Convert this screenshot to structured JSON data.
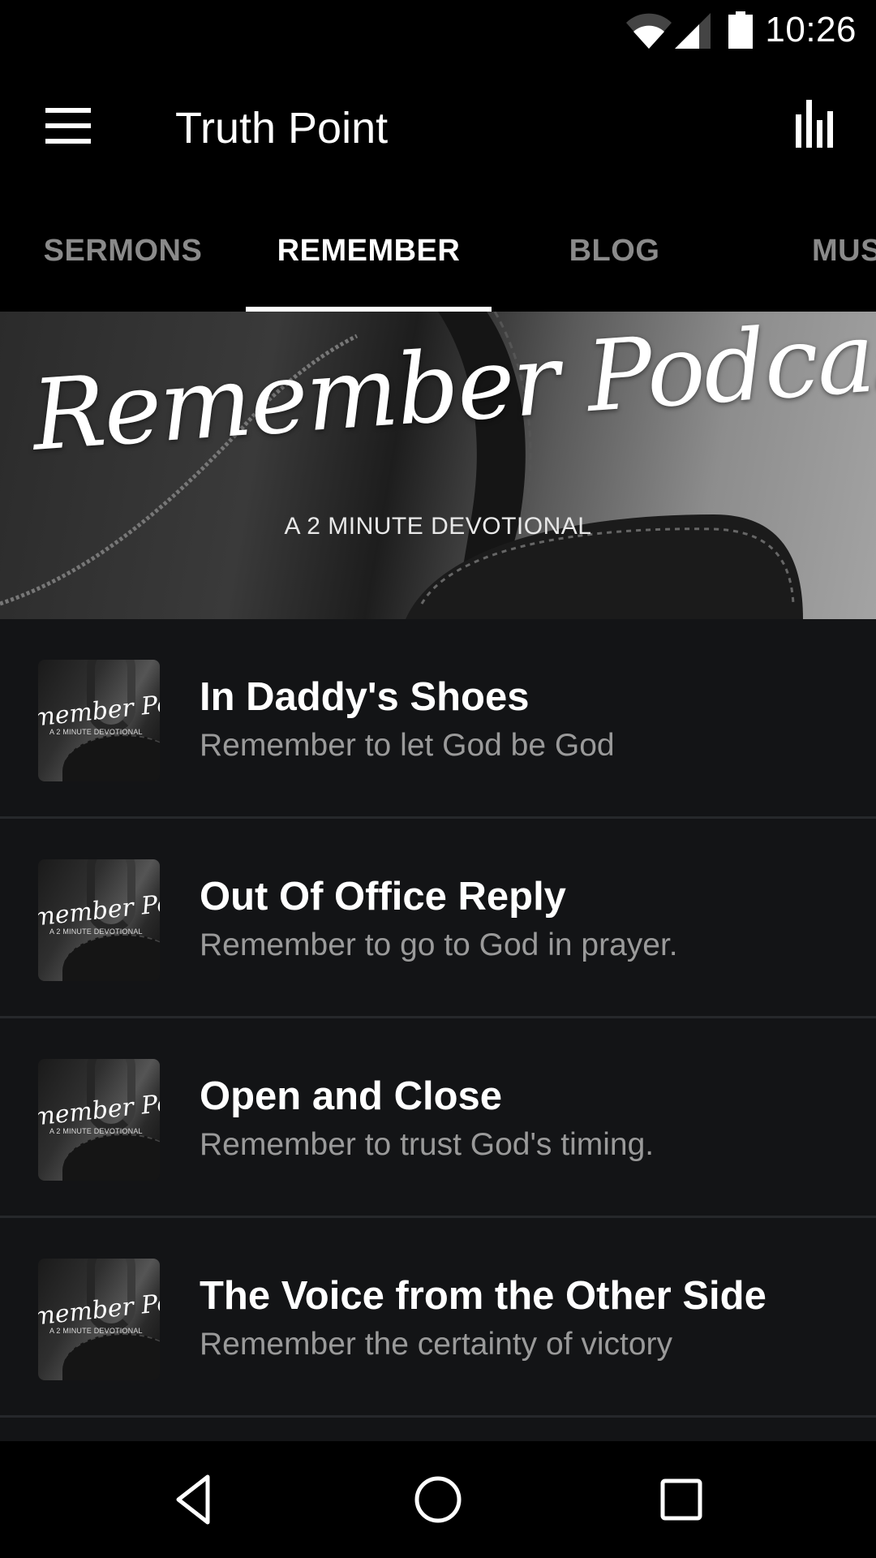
{
  "status_bar": {
    "time": "10:26",
    "icons": [
      "wifi-icon",
      "cell-signal-icon",
      "battery-icon"
    ]
  },
  "app_bar": {
    "title": "Truth Point",
    "menu_icon": "hamburger-menu-icon",
    "action_icon": "equalizer-icon"
  },
  "tabs": {
    "items": [
      {
        "label": "SERMONS",
        "active": false
      },
      {
        "label": "REMEMBER",
        "active": true
      },
      {
        "label": "BLOG",
        "active": false
      },
      {
        "label": "MUS",
        "active": false
      }
    ]
  },
  "banner": {
    "title": "Remember Podcast",
    "subtitle": "A 2 MINUTE DEVOTIONAL"
  },
  "thumbnail": {
    "title_fragment": "member Podc",
    "subtitle": "A 2 MINUTE DEVOTIONAL"
  },
  "episodes": [
    {
      "title": "In Daddy's Shoes",
      "subtitle": "Remember to let God be God"
    },
    {
      "title": "Out Of Office Reply",
      "subtitle": "Remember to go to God in prayer."
    },
    {
      "title": "Open and Close",
      "subtitle": "Remember to trust God's timing."
    },
    {
      "title": "The Voice from the Other Side",
      "subtitle": "Remember the certainty of victory"
    }
  ],
  "nav_bar": {
    "buttons": [
      "back-icon",
      "home-icon",
      "recents-icon"
    ]
  },
  "colors": {
    "background": "#000000",
    "list_background": "#131416",
    "separator": "#26282b",
    "tab_inactive": "#8a8a8a",
    "subtitle": "#9a9a9a",
    "accent": "#ffffff"
  }
}
